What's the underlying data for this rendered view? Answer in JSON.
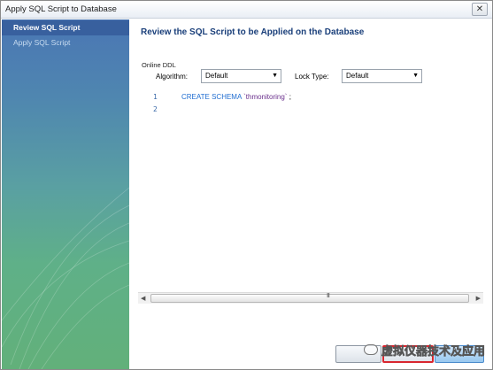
{
  "window": {
    "title": "Apply SQL Script to Database",
    "close_symbol": "✕"
  },
  "sidebar": {
    "items": [
      {
        "label": "Review SQL Script",
        "active": true
      },
      {
        "label": "Apply SQL Script",
        "active": false
      }
    ]
  },
  "main": {
    "title": "Review the SQL Script to be Applied on the Database",
    "online_ddl": {
      "group_label": "Online DDL",
      "algorithm_label": "Algorithm:",
      "algorithm_value": "Default",
      "lock_label": "Lock Type:",
      "lock_value": "Default"
    },
    "editor": {
      "lines": [
        {
          "number": "1",
          "keyword": "CREATE SCHEMA",
          "string": "`thmonitoring`",
          "end": ";"
        },
        {
          "number": "2"
        }
      ]
    },
    "scrollbar": {
      "grip": "III"
    }
  },
  "watermark": {
    "text": "虚拟仪器技术及应用"
  },
  "colors": {
    "title_blue": "#1a3f7a",
    "apply_highlight": "#d8262f",
    "keyword_blue": "#1f6dd1"
  }
}
